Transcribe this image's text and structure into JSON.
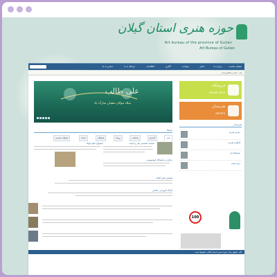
{
  "window": {
    "controls": [
      "dot",
      "dot",
      "dot"
    ]
  },
  "header": {
    "logo_title": "حوزه هنری استان گیلان",
    "logo_subtitle": "Art bureau of the province of Guilan",
    "logo_subtitle2": "Art Bureau of Guilan"
  },
  "nav": {
    "items": [
      "صفحه نخست",
      "درباره ما",
      "اخبار",
      "تولیدات",
      "گالری",
      "اطلاعات",
      "ارتباط با ما",
      "تماس با ما"
    ]
  },
  "breadcrumb": "خانه › اخبار و اطلاع‌رسانی",
  "banner": {
    "title": "علی طالب",
    "caption": "میلاد مولای متقیان مبارک باد"
  },
  "promos": [
    {
      "title": "فروشگاه",
      "subtitle": "ONLINE SHOP"
    },
    {
      "title": "هنرمندان",
      "subtitle": "ARTISTS"
    }
  ],
  "tabs": [
    "اخبار",
    "گزارش",
    "یادداشت",
    "رویداد",
    "فرهنگی",
    "ادبیات",
    "هنرهای تجسمی"
  ],
  "section_headers": {
    "news": "تازه‌ها",
    "side": "هنرمندان"
  },
  "news_titles": [
    "نشست تخصصی هنر و ادبیات",
    "برگزاری نمایشگاه خوشنویسی",
    "جشنواره فیلم کوتاه",
    "همایش شعر انقلاب",
    "کارگاه آموزشی عکاسی"
  ],
  "side_items": [
    "معرفی هنرمند",
    "گفتگو با هنرمند",
    "نمایشگاه آثار",
    "برنامه هفته"
  ],
  "speed_label": "100",
  "footer": "کلیه حقوق برای حوزه هنری استان گیلان محفوظ است"
}
